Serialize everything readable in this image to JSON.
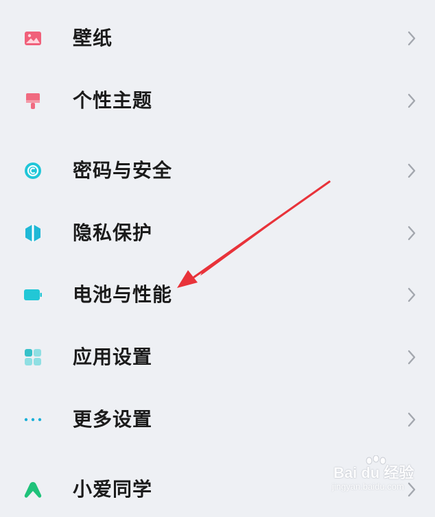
{
  "settings": {
    "items": [
      {
        "label": "壁纸",
        "icon": "wallpaper-icon",
        "color": "#f0607a"
      },
      {
        "label": "个性主题",
        "icon": "theme-brush-icon",
        "color": "#f06a80"
      },
      {
        "label": "密码与安全",
        "icon": "password-security-icon",
        "color": "#20c6d8"
      },
      {
        "label": "隐私保护",
        "icon": "privacy-shield-icon",
        "color": "#1fb8d6"
      },
      {
        "label": "电池与性能",
        "icon": "battery-icon",
        "color": "#22c7d6"
      },
      {
        "label": "应用设置",
        "icon": "app-grid-icon",
        "color": "#36c1c9"
      },
      {
        "label": "更多设置",
        "icon": "more-dots-icon",
        "color": "#1ab0d8"
      },
      {
        "label": "小爱同学",
        "icon": "xiaoai-icon",
        "color": "#1fc27a"
      }
    ]
  },
  "annotation": {
    "arrow_color": "#e8333a",
    "target": "电池与性能"
  },
  "watermark": {
    "line1": "Bai du 经验",
    "line2": "jingyan.baidu.com"
  }
}
